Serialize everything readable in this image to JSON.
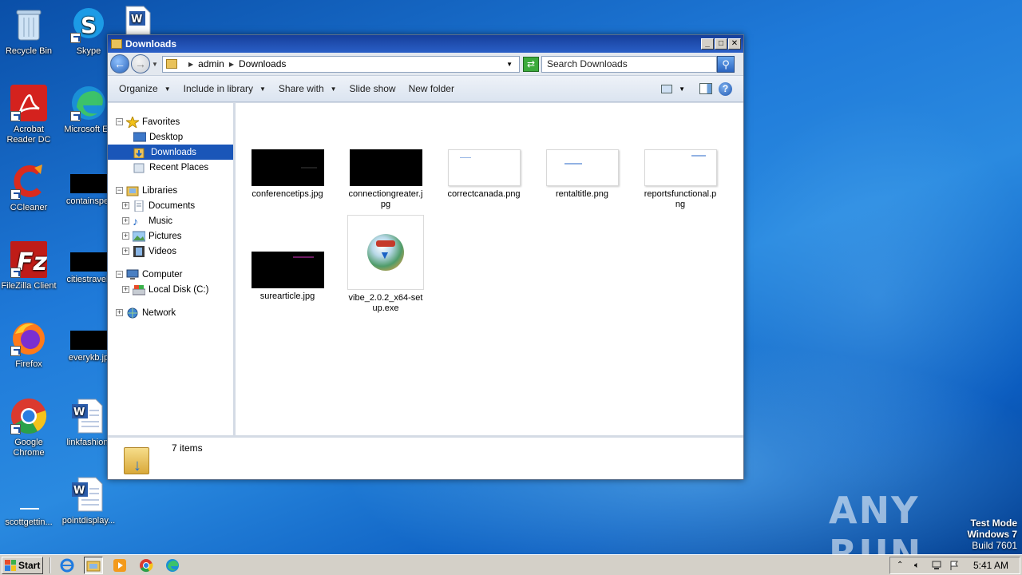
{
  "desktop": {
    "icons": [
      {
        "label": "Recycle Bin",
        "icon": "recycle-bin-icon"
      },
      {
        "label": "Skype",
        "icon": "skype-icon"
      },
      {
        "label": "Acrobat Reader DC",
        "icon": "acrobat-icon"
      },
      {
        "label": "Microsoft Ed",
        "icon": "edge-icon"
      },
      {
        "label": "CCleaner",
        "icon": "ccleaner-icon"
      },
      {
        "label": "containspet",
        "icon": "image-file-icon"
      },
      {
        "label": "FileZilla Client",
        "icon": "filezilla-icon"
      },
      {
        "label": "citiestravel.",
        "icon": "image-file-icon"
      },
      {
        "label": "Firefox",
        "icon": "firefox-icon"
      },
      {
        "label": "everykb.jp",
        "icon": "image-file-icon"
      },
      {
        "label": "Google Chrome",
        "icon": "chrome-icon"
      },
      {
        "label": "linkfashion.",
        "icon": "word-doc-icon"
      },
      {
        "label": "scottgettin...",
        "icon": "blank-file-icon"
      },
      {
        "label": "pointdisplay...",
        "icon": "word-doc-icon"
      }
    ],
    "watermark": "ANY RUN",
    "testmode": {
      "line1": "Test Mode",
      "line2": "Windows 7",
      "line3": "Build 7601"
    }
  },
  "window": {
    "title": "Downloads",
    "address": {
      "crumb1": "admin",
      "crumb2": "Downloads"
    },
    "search_placeholder": "Search Downloads",
    "toolbar": {
      "organize": "Organize",
      "include": "Include in library",
      "share": "Share with",
      "slideshow": "Slide show",
      "newfolder": "New folder"
    },
    "nav": {
      "favorites": "Favorites",
      "desktop": "Desktop",
      "downloads": "Downloads",
      "recent": "Recent Places",
      "libraries": "Libraries",
      "documents": "Documents",
      "music": "Music",
      "pictures": "Pictures",
      "videos": "Videos",
      "computer": "Computer",
      "localdisk": "Local Disk (C:)",
      "network": "Network"
    },
    "files": [
      {
        "name": "conferencetips.jpg",
        "thumb": "black"
      },
      {
        "name": "connectiongreater.jpg",
        "thumb": "black"
      },
      {
        "name": "correctcanada.png",
        "thumb": "white"
      },
      {
        "name": "rentaltitle.png",
        "thumb": "white"
      },
      {
        "name": "reportsfunctional.png",
        "thumb": "white"
      },
      {
        "name": "surearticle.jpg",
        "thumb": "black"
      },
      {
        "name": "vibe_2.0.2_x64-setup.exe",
        "thumb": "exe"
      }
    ],
    "status": "7 items"
  },
  "taskbar": {
    "start": "Start",
    "clock": "5:41 AM"
  }
}
